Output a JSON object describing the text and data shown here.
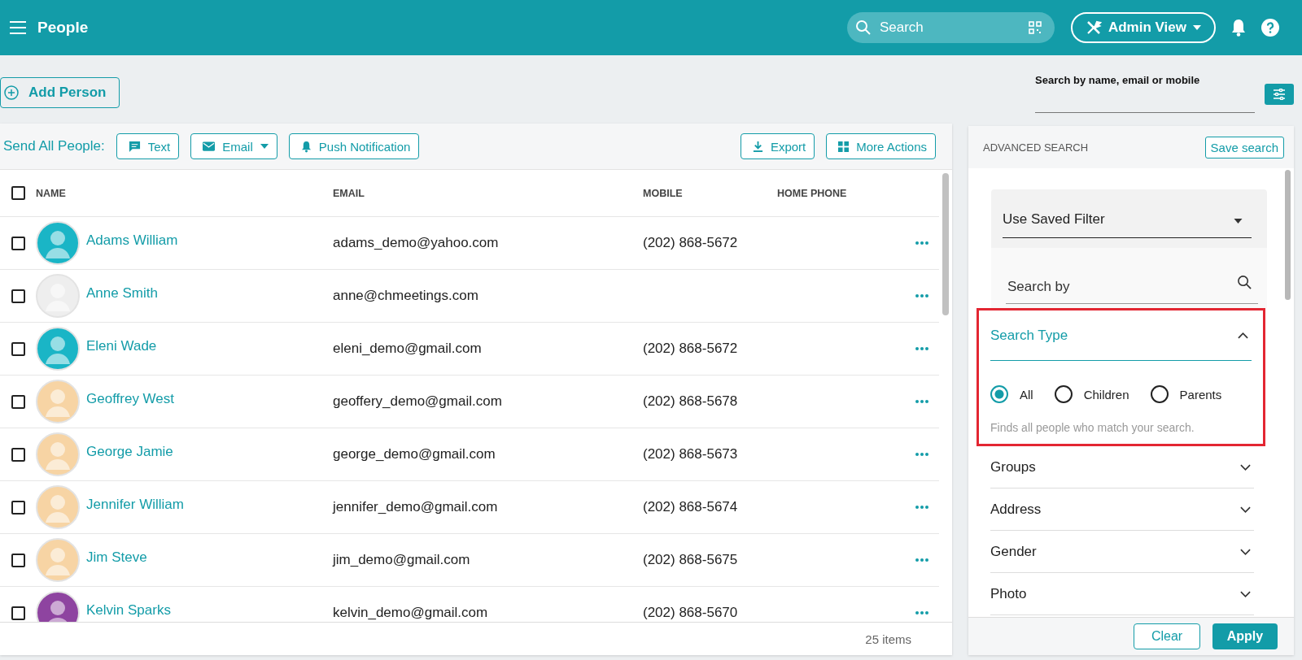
{
  "top_bar": {
    "title": "People",
    "search": {
      "placeholder": "Search"
    },
    "view_button": "Admin View"
  },
  "add_person_button": "Add Person",
  "quick_search": {
    "label": "Search by name, email or mobile"
  },
  "toolbar": {
    "label": "Send All People:",
    "actions": [
      {
        "label": "Text",
        "kind": "text"
      },
      {
        "label": "Email",
        "kind": "email"
      },
      {
        "label": "Push Notification",
        "kind": "push"
      }
    ],
    "right_actions": [
      {
        "label": "Export",
        "kind": "export"
      },
      {
        "label": "More Actions",
        "kind": "grid"
      }
    ]
  },
  "table": {
    "columns": [
      "NAME",
      "EMAIL",
      "MOBILE",
      "HOME PHONE"
    ],
    "all_checked": false,
    "rows": [
      {
        "name": "Adams William",
        "email": "adams_demo@yahoo.com",
        "mobile": "(202) 868-5672",
        "checked": false,
        "color": "#1ab5c6"
      },
      {
        "name": "Anne Smith",
        "email": "anne@chmeetings.com",
        "mobile": "",
        "checked": false,
        "color": "#eeeeee"
      },
      {
        "name": "Eleni Wade",
        "email": "eleni_demo@gmail.com",
        "mobile": "(202) 868-5672",
        "checked": false,
        "color": "#1ab5c6"
      },
      {
        "name": "Geoffrey West",
        "email": "geoffery_demo@gmail.com",
        "mobile": "(202) 868-5678",
        "checked": false,
        "color": "#f7d4a4"
      },
      {
        "name": "George Jamie",
        "email": "george_demo@gmail.com",
        "mobile": "(202) 868-5673",
        "checked": false,
        "color": "#f7d4a4"
      },
      {
        "name": "Jennifer William",
        "email": "jennifer_demo@gmail.com",
        "mobile": "(202) 868-5674",
        "checked": false,
        "color": "#f7d4a4"
      },
      {
        "name": "Jim Steve",
        "email": "jim_demo@gmail.com",
        "mobile": "(202) 868-5675",
        "checked": false,
        "color": "#f7d4a4"
      },
      {
        "name": "Kelvin Sparks",
        "email": "kelvin_demo@gmail.com",
        "mobile": "(202) 868-5670",
        "checked": false,
        "color": "#8e44a0"
      }
    ],
    "footer": "25 items"
  },
  "advanced_search": {
    "title": "ADVANCED SEARCH",
    "save_button": "Save search",
    "saved_filter": {
      "placeholder": "Use Saved Filter"
    },
    "search_by": {
      "placeholder": "Search by"
    },
    "sections": [
      {
        "title": "Search Type",
        "expanded": true,
        "highlighted": true,
        "options": [
          {
            "label": "All",
            "selected": true
          },
          {
            "label": "Children",
            "selected": false
          },
          {
            "label": "Parents",
            "selected": false
          }
        ],
        "hint": "Finds all people who match your search."
      },
      {
        "title": "Groups",
        "expanded": false,
        "highlighted": false
      },
      {
        "title": "Address",
        "expanded": false,
        "highlighted": false
      },
      {
        "title": "Gender",
        "expanded": false,
        "highlighted": false
      },
      {
        "title": "Photo",
        "expanded": false,
        "highlighted": false
      }
    ],
    "clear_button": "Clear",
    "apply_button": "Apply"
  }
}
